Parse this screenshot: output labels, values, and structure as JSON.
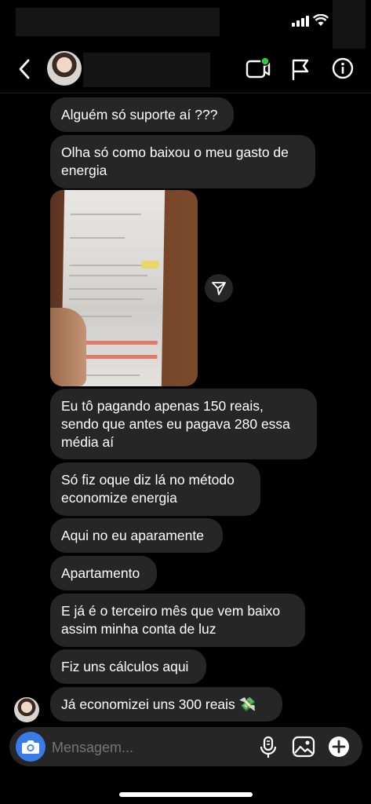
{
  "status_bar": {
    "icons": [
      "signal-icon",
      "wifi-icon",
      "battery-icon"
    ]
  },
  "header": {
    "icons": [
      "back-icon",
      "avatar",
      "video-call-icon",
      "flag-icon",
      "info-icon"
    ],
    "accent_color": "#2ecc40"
  },
  "messages": [
    {
      "type": "text",
      "text": "Alguém só suporte aí ???"
    },
    {
      "type": "text",
      "text": "Olha só como baixou o meu gasto de\nenergia"
    },
    {
      "type": "image",
      "icon": "photo-of-electricity-bill"
    },
    {
      "type": "text",
      "text": "Eu tô pagando apenas 150 reais,\nsendo que antes eu pagava 280 essa\nmédia aí"
    },
    {
      "type": "text",
      "text": "Só fiz oque diz lá no método\neconomize energia"
    },
    {
      "type": "text",
      "text": "Aqui no eu aparamente"
    },
    {
      "type": "text",
      "text": "Apartamento"
    },
    {
      "type": "text",
      "text": "E já é o terceiro mês que vem baixo\nassim minha conta de luz"
    },
    {
      "type": "text",
      "text": "Fiz uns cálculos aqui"
    },
    {
      "type": "text",
      "text": "Já economizei uns 300 reais 💸"
    }
  ],
  "composer": {
    "placeholder": "Mensagem...",
    "icons": [
      "camera-icon",
      "microphone-icon",
      "gallery-icon",
      "add-icon"
    ],
    "camera_color": "#3a7bea"
  }
}
